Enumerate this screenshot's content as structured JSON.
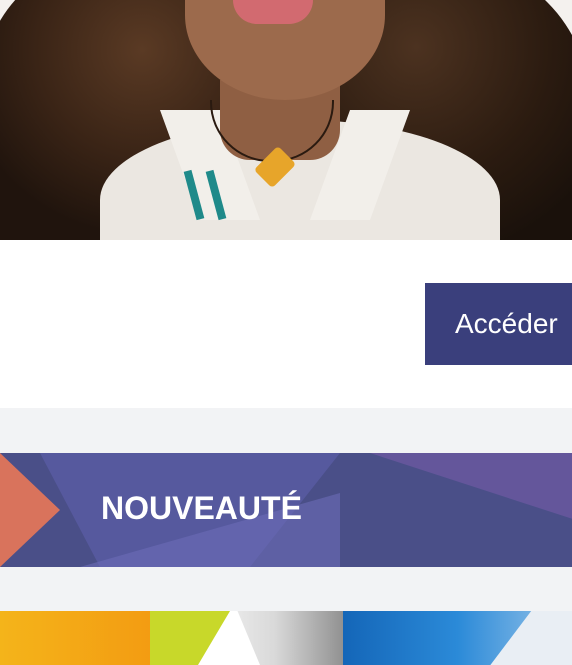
{
  "cta": {
    "label": "Accéder"
  },
  "banner": {
    "title": "NOUVEAUTÉ"
  },
  "colors": {
    "button_bg": "#3a3f7c",
    "band_bg": "#f2f3f5",
    "banner_bg": "#4a4f88",
    "banner_accent": "#d9735c"
  }
}
